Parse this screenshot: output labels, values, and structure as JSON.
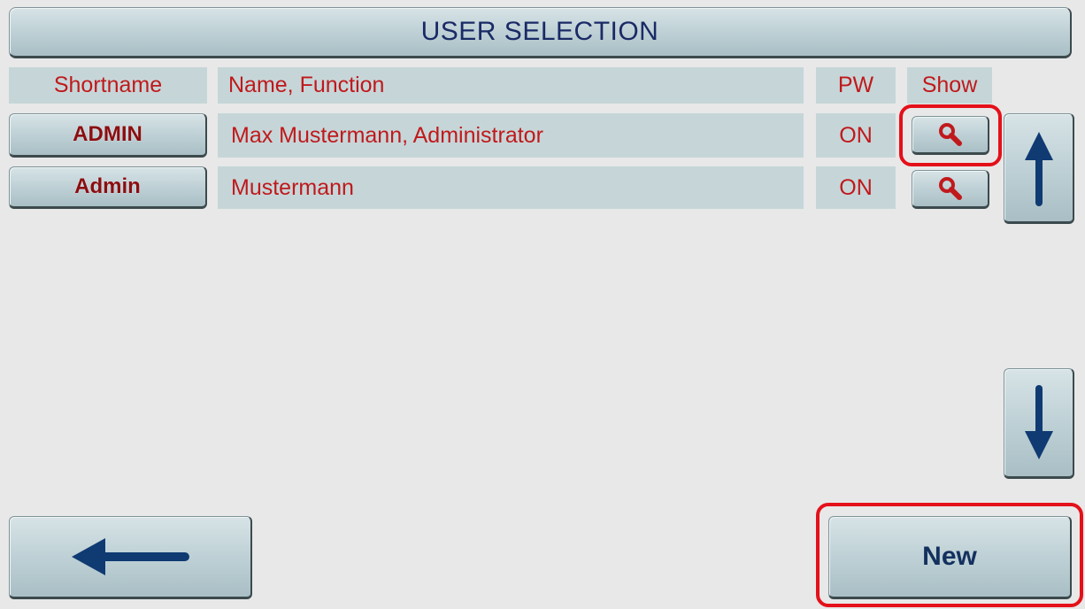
{
  "title": "USER SELECTION",
  "columns": {
    "shortname": "Shortname",
    "name_function": "Name, Function",
    "pw": "PW",
    "show": "Show"
  },
  "users": [
    {
      "shortname": "ADMIN",
      "name_function": "Max Mustermann, Administrator",
      "pw": "ON"
    },
    {
      "shortname": "Admin",
      "name_function": "Mustermann",
      "pw": "ON"
    }
  ],
  "footer": {
    "new_label": "New"
  },
  "icons": {
    "show": "magnifier-icon",
    "scroll_up": "arrow-up-icon",
    "scroll_down": "arrow-down-icon",
    "back": "arrow-left-icon"
  },
  "colors": {
    "background": "#e8e8e8",
    "cell": "#c6d6d8",
    "text_red": "#c0191c",
    "title_navy": "#1a2a66",
    "arrow_navy": "#0f3a72",
    "highlight": "#e4101a"
  }
}
